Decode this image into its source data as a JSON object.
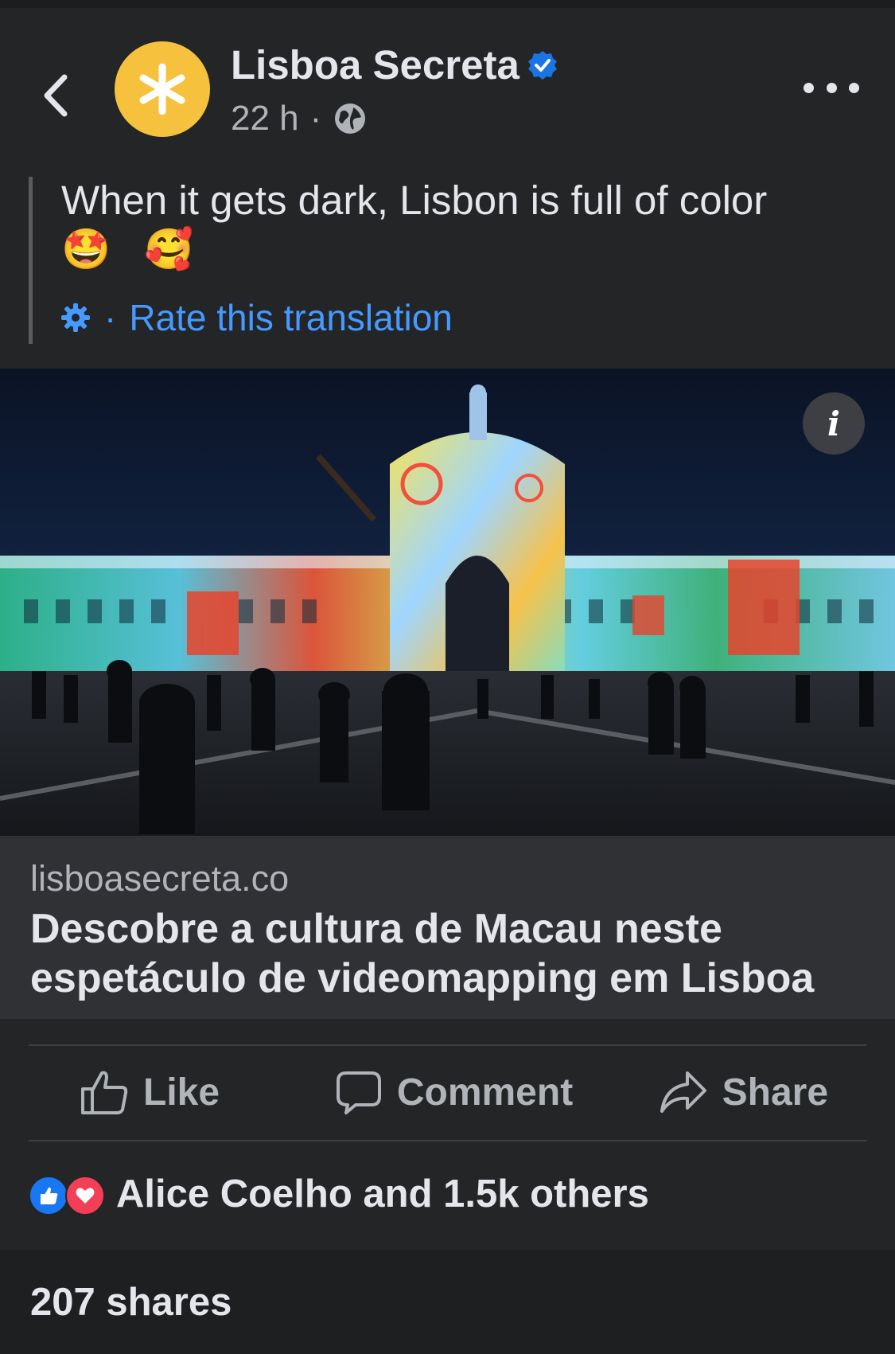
{
  "header": {
    "page_name": "Lisboa Secreta",
    "time": "22 h",
    "separator": "·",
    "icons": {
      "back": "chevron-left-icon",
      "verified": "verified-badge-icon",
      "audience": "globe-icon",
      "more": "more-dots-icon"
    }
  },
  "post": {
    "text": "When it gets dark, Lisbon is full of color",
    "emoji_1": "🤩",
    "emoji_2": "🥰",
    "translation_separator": "·",
    "rate_translation": "Rate this translation"
  },
  "photo": {
    "info_label": "i"
  },
  "link_card": {
    "domain": "lisboasecreta.co",
    "title": "Descobre a cultura de Macau neste espetáculo de videomapping em Lisboa"
  },
  "actions": {
    "like": "Like",
    "comment": "Comment",
    "share": "Share"
  },
  "reactions": {
    "summary": "Alice Coelho and 1.5k others"
  },
  "shares": {
    "label": "207 shares"
  },
  "colors": {
    "background": "#242526",
    "link_blue": "#4599ff",
    "avatar_yellow": "#f6c23e",
    "like_blue": "#1877f2",
    "love_red": "#f33e58"
  }
}
